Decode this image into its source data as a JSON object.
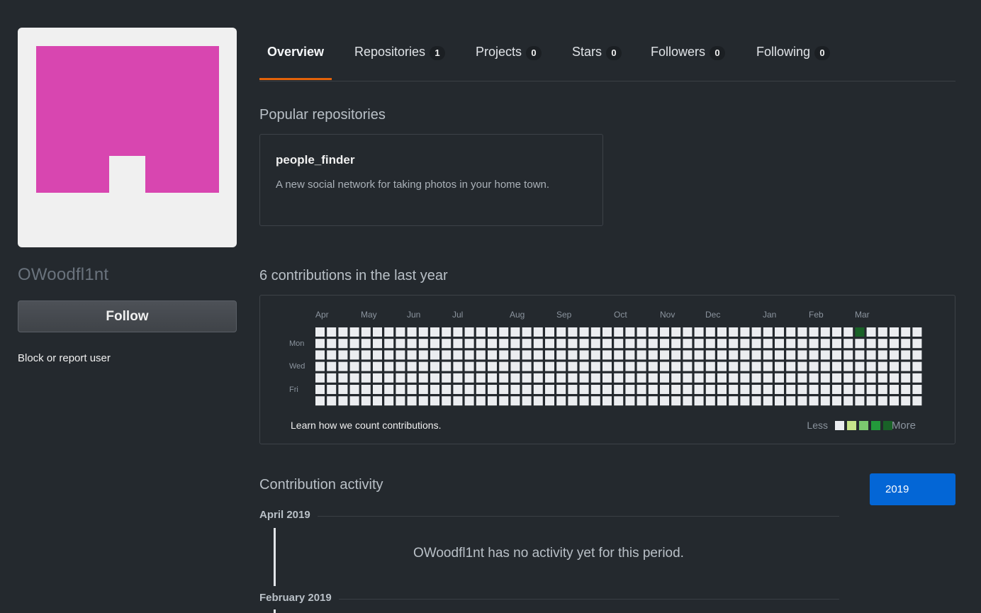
{
  "profile": {
    "username": "OWoodfl1nt",
    "follow_label": "Follow",
    "block_label": "Block or report user",
    "avatar_color": "#d846b0"
  },
  "tabs": [
    {
      "label": "Overview",
      "count": null,
      "active": true
    },
    {
      "label": "Repositories",
      "count": "1"
    },
    {
      "label": "Projects",
      "count": "0"
    },
    {
      "label": "Stars",
      "count": "0"
    },
    {
      "label": "Followers",
      "count": "0"
    },
    {
      "label": "Following",
      "count": "0"
    }
  ],
  "popular": {
    "title": "Popular repositories",
    "repo": {
      "name": "people_finder",
      "description": "A new social network for taking photos in your home town."
    }
  },
  "contributions": {
    "title": "6 contributions in the last year",
    "months": [
      "Apr",
      "May",
      "Jun",
      "Jul",
      "Aug",
      "Sep",
      "Oct",
      "Nov",
      "Dec",
      "Jan",
      "Feb",
      "Mar"
    ],
    "days": [
      "Mon",
      "Wed",
      "Fri"
    ],
    "learn": "Learn how we count contributions.",
    "legend_less": "Less",
    "legend_more": "More",
    "legend_colors": [
      "#ebedf0",
      "#c6e48b",
      "#7bc96f",
      "#239a3b",
      "#196127"
    ],
    "active_cell_color": "#196127"
  },
  "activity": {
    "title": "Contribution activity",
    "year_button": "2019",
    "periods": [
      "April 2019",
      "February 2019"
    ],
    "no_activity": "OWoodfl1nt has no activity yet for this period."
  }
}
